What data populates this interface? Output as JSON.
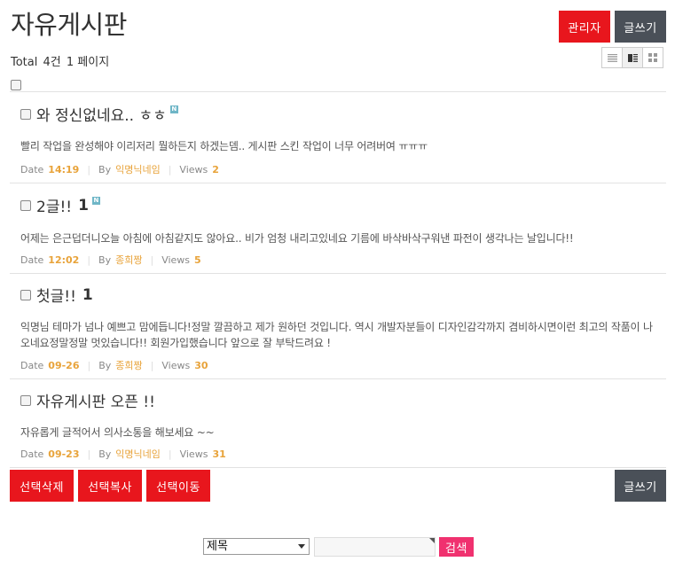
{
  "header": {
    "title": "자유게시판",
    "admin_label": "관리자",
    "write_label": "글쓰기",
    "total_label": "Total",
    "total_count": "4건",
    "page_label": "1 페이지"
  },
  "posts": [
    {
      "subject": "와 정신없네요.. ㅎㅎ",
      "comment_count": "",
      "is_new": true,
      "summary": "빨리 작업을 완성해야 이리저리 뭘하든지 하겠는뎀.. 게시판 스킨 작업이 너무 어려버여 ㅠㅠㅠ",
      "date_label": "Date",
      "date": "14:19",
      "by_label": "By",
      "author": "익명닉네임",
      "views_label": "Views",
      "views": "2"
    },
    {
      "subject": "2글!!",
      "comment_count": "1",
      "is_new": true,
      "summary": "어제는 은근덥더니오늘 아침에 아침같지도 않아요.. 비가 엄청 내리고있네요 기름에 바삭바삭구워낸 파전이 생각나는 날입니다!!",
      "date_label": "Date",
      "date": "12:02",
      "by_label": "By",
      "author": "종희짱",
      "views_label": "Views",
      "views": "5"
    },
    {
      "subject": "첫글!!",
      "comment_count": "1",
      "is_new": false,
      "summary": "익명님 테마가 넘나 예쁘고 맘에듭니다!정말 깔끔하고 제가 원하던 것입니다. 역시 개발자분들이 디자인감각까지 겸비하시면이런 최고의 작품이 나오네요정말정말 멋있습니다!! 회원가입했습니다 앞으로 잘 부탁드려요 !",
      "date_label": "Date",
      "date": "09-26",
      "by_label": "By",
      "author": "종희짱",
      "views_label": "Views",
      "views": "30"
    },
    {
      "subject": "자유게시판 오픈 !!",
      "comment_count": "",
      "is_new": false,
      "summary": "자유롭게 글적어서 의사소통을 해보세요 ~~",
      "date_label": "Date",
      "date": "09-23",
      "by_label": "By",
      "author": "익명닉네임",
      "views_label": "Views",
      "views": "31"
    }
  ],
  "bottom": {
    "delete_label": "선택삭제",
    "copy_label": "선택복사",
    "move_label": "선택이동",
    "write_label": "글쓰기"
  },
  "search": {
    "field_selected": "제목",
    "query": "",
    "button_label": "검색"
  },
  "colors": {
    "accent_red": "#e8161d",
    "dark_button": "#4a5058",
    "meta_value": "#e8a33a",
    "search_button": "#f0316f",
    "new_badge": "#6fb6c7"
  },
  "icons": {
    "new_badge": "N",
    "view_list": "list-view-icon",
    "view_webzine": "webzine-view-icon",
    "view_gallery": "gallery-view-icon"
  }
}
